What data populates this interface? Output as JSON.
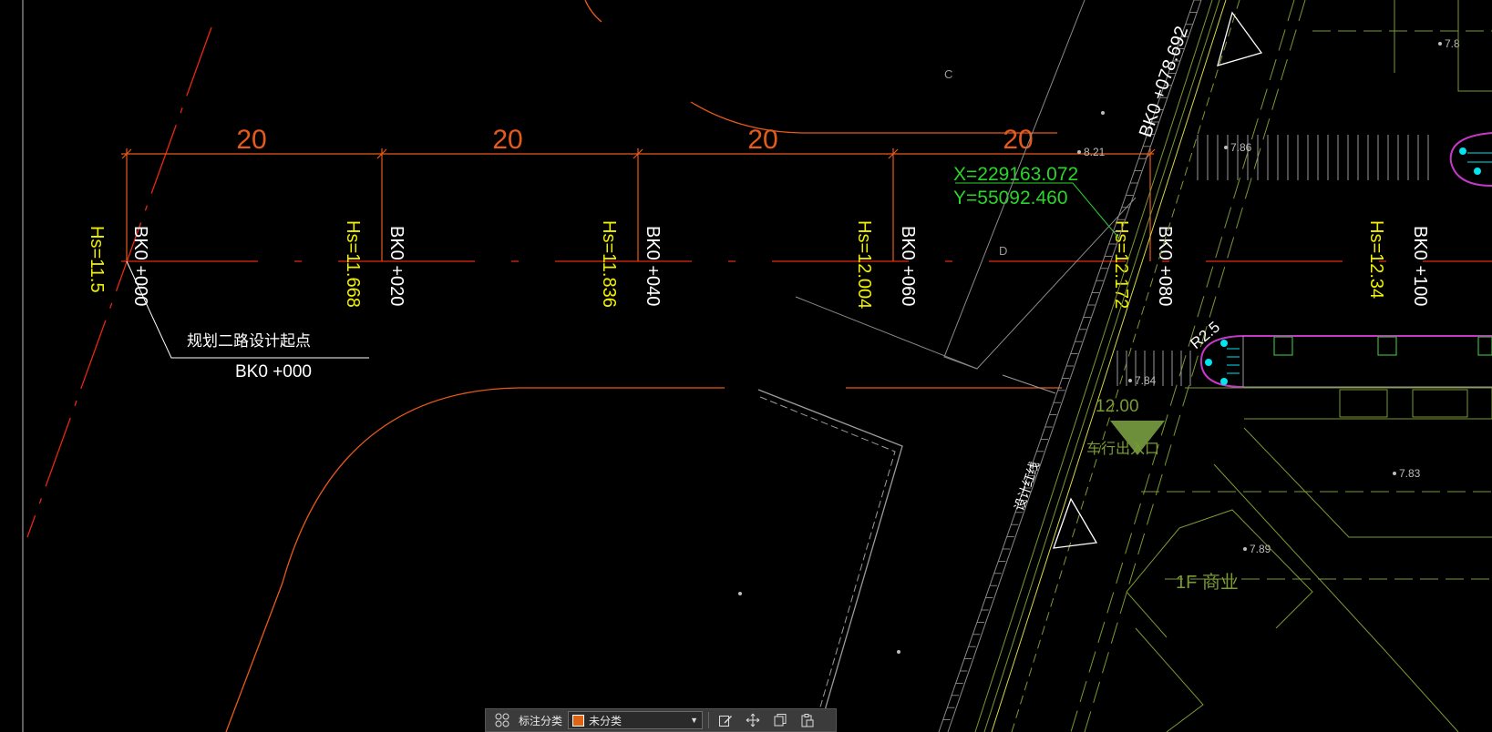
{
  "drawing": {
    "dims": [
      "20",
      "20",
      "20",
      "20"
    ],
    "stations": [
      {
        "label": "BK0 +000",
        "hs": "Hs=11.5"
      },
      {
        "label": "BK0 +020",
        "hs": "Hs=11.668"
      },
      {
        "label": "BK0 +040",
        "hs": "Hs=11.836"
      },
      {
        "label": "BK0 +060",
        "hs": "Hs=12.004"
      },
      {
        "label": "BK0 +080",
        "hs": "Hs=12.172"
      },
      {
        "label": "BK0 +100",
        "hs": "Hs=12.34"
      }
    ],
    "start_note": "规划二路设计起点",
    "start_station": "BK0 +000",
    "coord_x": "X=229163.072",
    "coord_y": "Y=55092.460",
    "road_station": "BK0 +078.692",
    "elevations": {
      "e821": "8.21",
      "e786": "7.86",
      "e784": "7.84",
      "e783": "7.83",
      "e789": "7.89",
      "e78": "7.8"
    },
    "radius": "R2.5",
    "width_label": "12.00",
    "entrance_label": "车行出入口",
    "redline_label": "设计红线",
    "building_label": "1F 商业",
    "letter_c": "C",
    "letter_d": "D"
  },
  "toolbar": {
    "label": "标注分类",
    "selected": "未分类",
    "swatch_color": "#e06414"
  },
  "colors": {
    "background": "#000000",
    "dimension": "#e85a1a",
    "centerline": "#e82810",
    "elevation_text": "#f2f000",
    "station_text": "#ffffff",
    "coordinate_text": "#2ad52a",
    "redline": "#d8d84a",
    "building": "#7a9a32",
    "parking": "#c838c8",
    "cyan": "#00e5f0"
  }
}
